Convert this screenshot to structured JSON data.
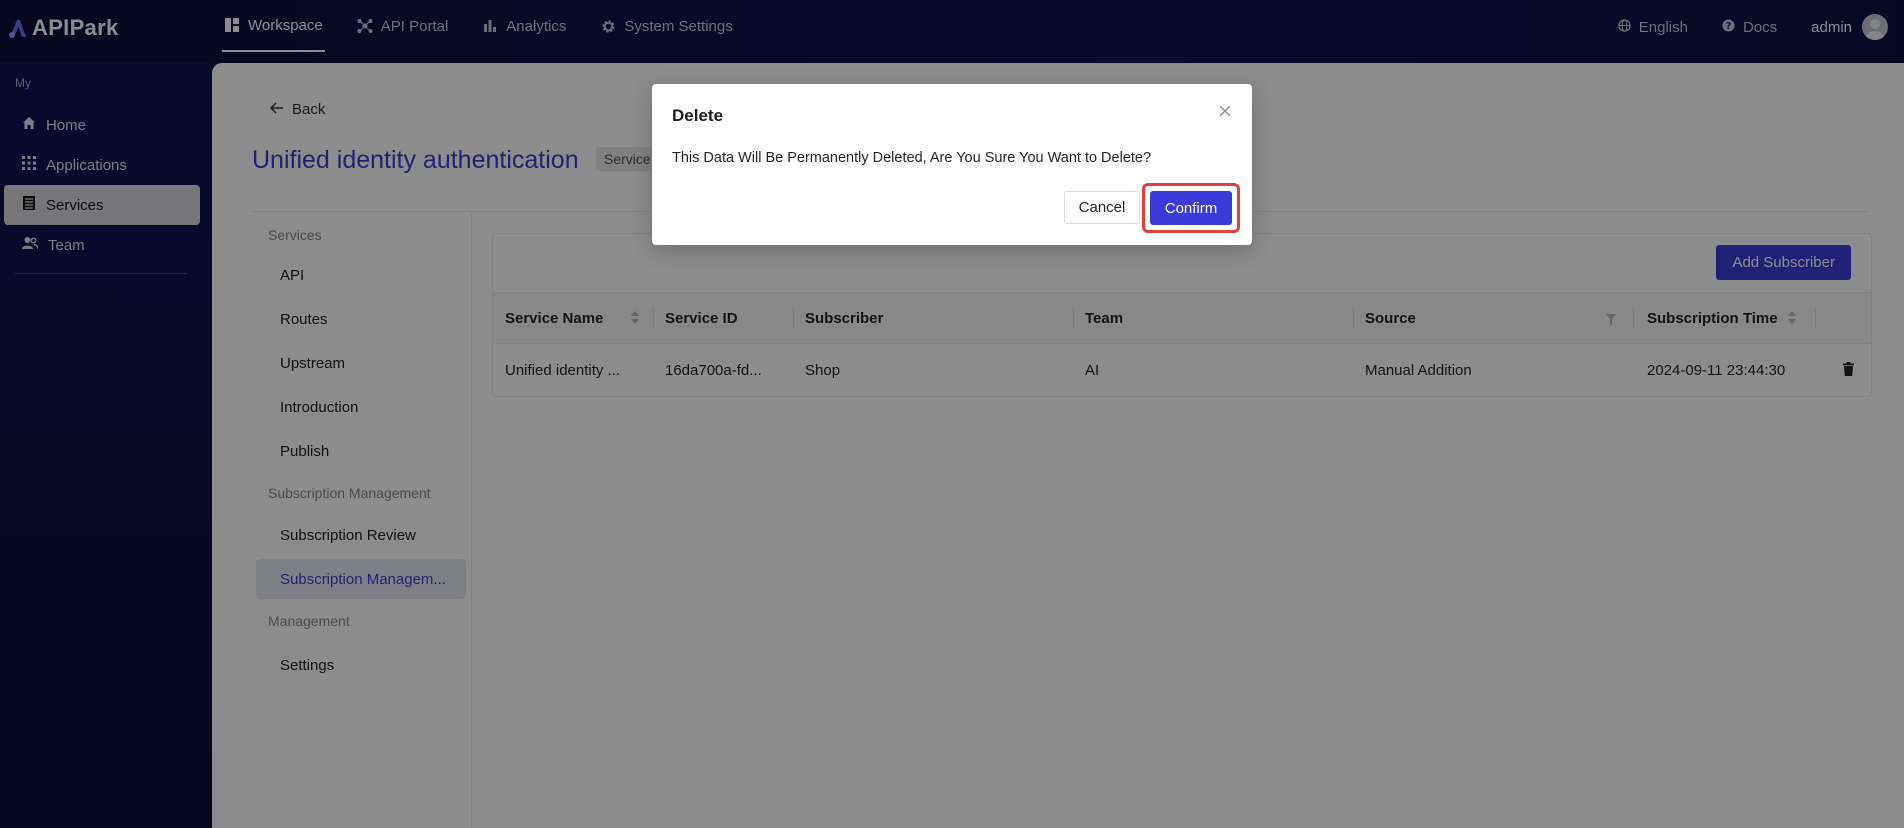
{
  "app": {
    "name": "APIPark"
  },
  "topnav": {
    "items": [
      {
        "label": "Workspace",
        "icon": "dashboard-icon",
        "active": true
      },
      {
        "label": "API Portal",
        "icon": "portal-icon",
        "active": false
      },
      {
        "label": "Analytics",
        "icon": "bar-chart-icon",
        "active": false
      },
      {
        "label": "System Settings",
        "icon": "gear-icon",
        "active": false
      }
    ],
    "language": "English",
    "docs": "Docs",
    "user": "admin"
  },
  "sidebar": {
    "section": "My",
    "items": [
      {
        "label": "Home",
        "icon": "home-icon",
        "active": false
      },
      {
        "label": "Applications",
        "icon": "grid-icon",
        "active": false
      },
      {
        "label": "Services",
        "icon": "services-icon",
        "active": true
      },
      {
        "label": "Team",
        "icon": "team-icon",
        "active": false
      }
    ]
  },
  "page": {
    "back_label": "Back",
    "title": "Unified identity authentication",
    "tag": "Service"
  },
  "subnav": {
    "groups": [
      {
        "label": "Services",
        "items": [
          "API",
          "Routes",
          "Upstream",
          "Introduction",
          "Publish"
        ]
      },
      {
        "label": "Subscription Management",
        "items": [
          "Subscription Review",
          "Subscription Managem..."
        ]
      },
      {
        "label": "Management",
        "items": [
          "Settings"
        ]
      }
    ],
    "active_item": "Subscription Managem..."
  },
  "table": {
    "add_button": "Add Subscriber",
    "columns": [
      "Service Name",
      "Service ID",
      "Subscriber",
      "Team",
      "Source",
      "Subscription Time"
    ],
    "rows": [
      {
        "service_name": "Unified identity ...",
        "service_id": "16da700a-fd...",
        "subscriber": "Shop",
        "team": "AI",
        "source": "Manual Addition",
        "subscription_time": "2024-09-11 23:44:30"
      }
    ]
  },
  "modal": {
    "title": "Delete",
    "message": "This Data Will Be Permanently Deleted, Are You Sure You Want to Delete?",
    "cancel_label": "Cancel",
    "confirm_label": "Confirm"
  },
  "colors": {
    "accent": "#3b3bd9",
    "highlight": "#e2403b",
    "nav_bg": "#10104a"
  }
}
